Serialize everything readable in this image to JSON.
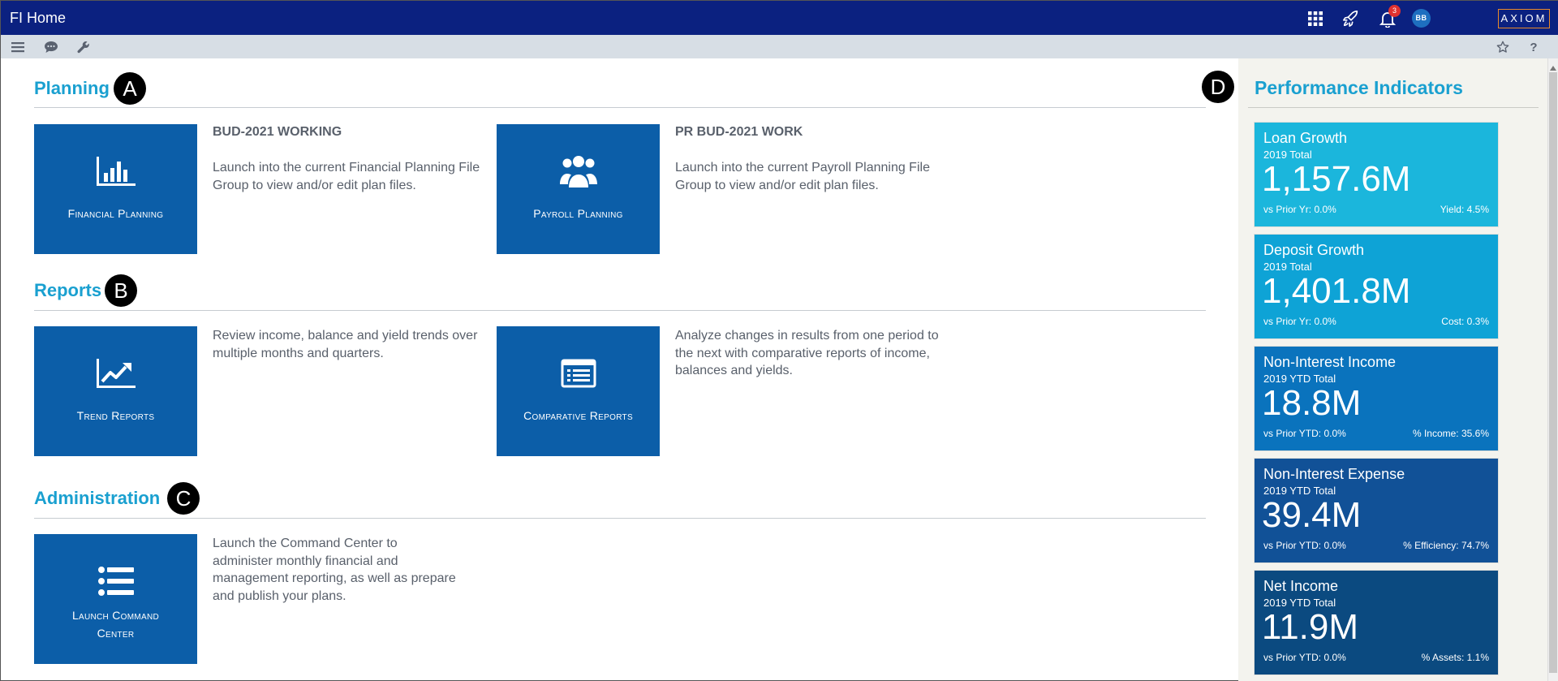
{
  "header": {
    "title": "FI Home",
    "notification_count": "3",
    "avatar_initials": "BB",
    "logo_text": "AXIOM"
  },
  "toolbar": {
    "icons": [
      "menu-icon",
      "chat-icon",
      "wrench-icon",
      "star-icon",
      "help-icon"
    ],
    "help_label": "?"
  },
  "callouts": {
    "a": "A",
    "b": "B",
    "c": "C",
    "d": "D"
  },
  "planning": {
    "title": "Planning",
    "tiles": [
      {
        "label": "Financial Planning",
        "icon": "bar-chart-icon",
        "desc_title": "BUD-2021 WORKING",
        "desc": "Launch into the current Financial Planning File Group to view and/or edit plan files."
      },
      {
        "label": "Payroll Planning",
        "icon": "users-icon",
        "desc_title": "PR BUD-2021 WORK",
        "desc": "Launch into the current Payroll Planning File Group to view and/or edit plan files."
      }
    ]
  },
  "reports": {
    "title": "Reports",
    "tiles": [
      {
        "label": "Trend Reports",
        "icon": "trend-chart-icon",
        "desc": "Review income, balance and yield trends over multiple months and quarters."
      },
      {
        "label": "Comparative Reports",
        "icon": "report-list-icon",
        "desc": "Analyze changes in results from one period to the next with comparative reports of income, balances and yields."
      }
    ]
  },
  "administration": {
    "title": "Administration",
    "tiles": [
      {
        "label_line1": "Launch Command",
        "label_line2": "Center",
        "icon": "list-icon",
        "desc": "Launch the Command Center to administer monthly financial and management reporting, as well as prepare and publish your plans."
      }
    ]
  },
  "performance": {
    "title": "Performance Indicators",
    "kpis": [
      {
        "name": "Loan Growth",
        "sub": "2019 Total",
        "value": "1,157.6M",
        "left": "vs Prior Yr: 0.0%",
        "right": "Yield: 4.5%",
        "color": "#1bb6dc"
      },
      {
        "name": "Deposit Growth",
        "sub": "2019 Total",
        "value": "1,401.8M",
        "left": "vs Prior Yr: 0.0%",
        "right": "Cost: 0.3%",
        "color": "#0ea3d6"
      },
      {
        "name": "Non-Interest Income",
        "sub": "2019 YTD Total",
        "value": "18.8M",
        "left": "vs Prior YTD: 0.0%",
        "right": "% Income: 35.6%",
        "color": "#0a73bd"
      },
      {
        "name": "Non-Interest Expense",
        "sub": "2019 YTD Total",
        "value": "39.4M",
        "left": "vs Prior YTD: 0.0%",
        "right": "% Efficiency: 74.7%",
        "color": "#115197"
      },
      {
        "name": "Net Income",
        "sub": "2019 YTD Total",
        "value": "11.9M",
        "left": "vs Prior YTD: 0.0%",
        "right": "% Assets: 1.1%",
        "color": "#0b4a80"
      }
    ]
  }
}
